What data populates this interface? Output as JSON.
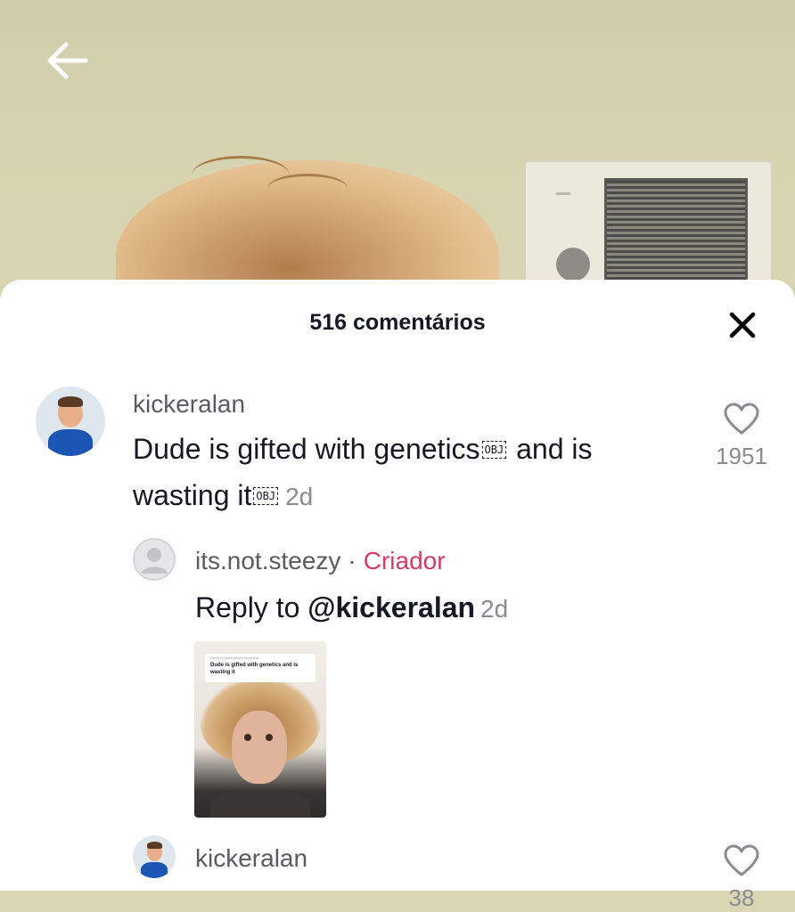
{
  "header": {
    "back_icon": "arrow-left-icon"
  },
  "sheet": {
    "title": "516 comentários",
    "close_icon": "close-icon"
  },
  "comments": [
    {
      "username": "kickeralan",
      "text_part1": "Dude is gifted with genetics",
      "obj_glyph": "OBJ",
      "text_part2": " and is",
      "text_line2": "wasting it",
      "obj_glyph2": "OBJ",
      "time": "2d",
      "likes": "1951",
      "like_icon": "heart-outline-icon"
    },
    {
      "username": "its.not.steezy",
      "separator": "·",
      "creator_badge": "Criador",
      "reply_prefix": "Reply to ",
      "mention": "@kickeralan",
      "time": "2d",
      "video_thumb": {
        "small_caption": "Reply to kickeralan's comment",
        "caption": "Dude is gifted with genetics and is wasting it"
      }
    },
    {
      "username": "kickeralan",
      "likes": "38",
      "like_icon": "heart-outline-icon"
    }
  ],
  "colors": {
    "creator": "#d53c64",
    "text_primary": "#161823",
    "text_secondary": "#8a8b91"
  }
}
